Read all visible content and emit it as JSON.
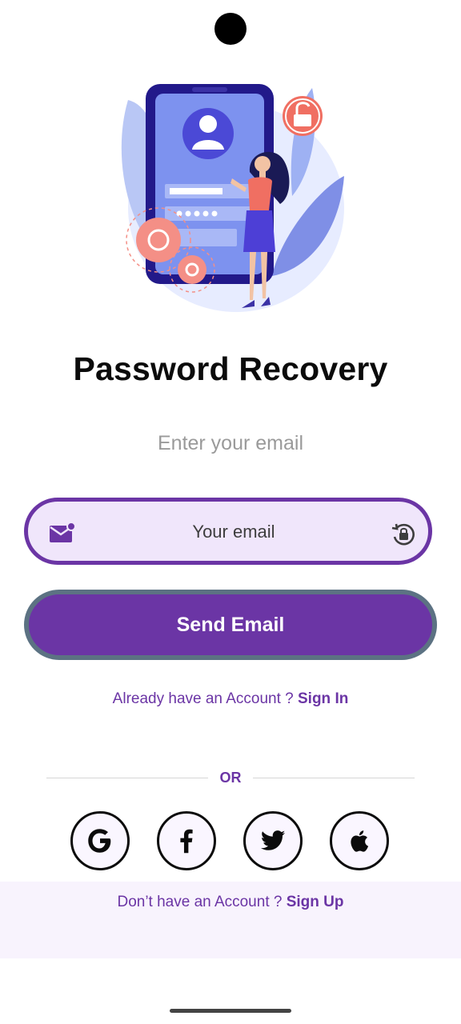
{
  "page": {
    "title": "Password Recovery",
    "subtitle": "Enter your email"
  },
  "email_field": {
    "placeholder": "Your email",
    "value": "",
    "leading_icon": "mail-icon",
    "trailing_icon": "lock-reset-icon"
  },
  "send_button": {
    "label": "Send Email"
  },
  "signin": {
    "prompt": "Already have an Account ? ",
    "link": "Sign In"
  },
  "divider": {
    "label": "OR"
  },
  "social_buttons": [
    {
      "icon": "google-icon"
    },
    {
      "icon": "facebook-icon"
    },
    {
      "icon": "twitter-icon"
    },
    {
      "icon": "apple-icon"
    }
  ],
  "signup": {
    "prompt": "Don’t have an Account ? ",
    "link": "Sign Up"
  },
  "colors": {
    "accent": "#6b35a5",
    "field_background": "#f0e6fb",
    "button_border": "#5c7283",
    "bottom_panel": "#f8f3fd"
  }
}
